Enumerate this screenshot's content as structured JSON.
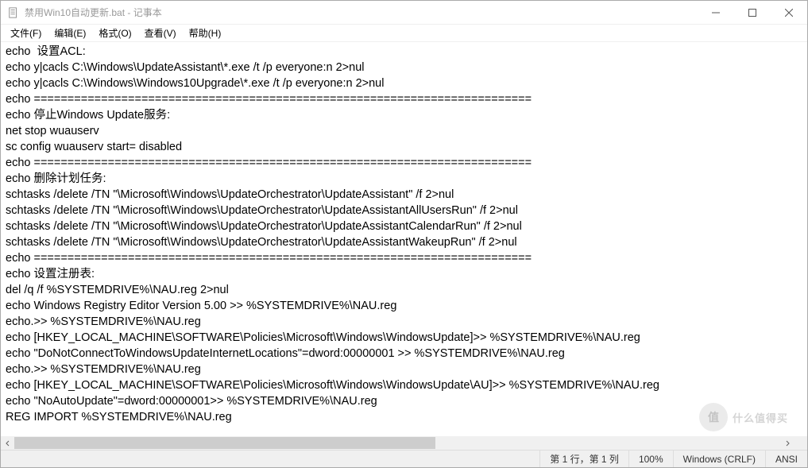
{
  "window": {
    "title": "禁用Win10自动更新.bat - 记事本"
  },
  "menu": {
    "file": "文件(F)",
    "edit": "编辑(E)",
    "format": "格式(O)",
    "view": "查看(V)",
    "help": "帮助(H)"
  },
  "content": {
    "lines": [
      "echo  设置ACL:",
      "echo y|cacls C:\\Windows\\UpdateAssistant\\*.exe /t /p everyone:n 2>nul",
      "echo y|cacls C:\\Windows\\Windows10Upgrade\\*.exe /t /p everyone:n 2>nul",
      "echo ==========================================================================",
      "echo 停止Windows Update服务:",
      "net stop wuauserv",
      "sc config wuauserv start= disabled",
      "echo ==========================================================================",
      "echo 删除计划任务:",
      "schtasks /delete /TN \"\\Microsoft\\Windows\\UpdateOrchestrator\\UpdateAssistant\" /f 2>nul",
      "schtasks /delete /TN \"\\Microsoft\\Windows\\UpdateOrchestrator\\UpdateAssistantAllUsersRun\" /f 2>nul",
      "schtasks /delete /TN \"\\Microsoft\\Windows\\UpdateOrchestrator\\UpdateAssistantCalendarRun\" /f 2>nul",
      "schtasks /delete /TN \"\\Microsoft\\Windows\\UpdateOrchestrator\\UpdateAssistantWakeupRun\" /f 2>nul",
      "echo ==========================================================================",
      "echo 设置注册表:",
      "del /q /f %SYSTEMDRIVE%\\NAU.reg 2>nul",
      "echo Windows Registry Editor Version 5.00 >> %SYSTEMDRIVE%\\NAU.reg",
      "echo.>> %SYSTEMDRIVE%\\NAU.reg",
      "echo [HKEY_LOCAL_MACHINE\\SOFTWARE\\Policies\\Microsoft\\Windows\\WindowsUpdate]>> %SYSTEMDRIVE%\\NAU.reg",
      "echo \"DoNotConnectToWindowsUpdateInternetLocations\"=dword:00000001 >> %SYSTEMDRIVE%\\NAU.reg",
      "echo.>> %SYSTEMDRIVE%\\NAU.reg",
      "echo [HKEY_LOCAL_MACHINE\\SOFTWARE\\Policies\\Microsoft\\Windows\\WindowsUpdate\\AU]>> %SYSTEMDRIVE%\\NAU.reg",
      "echo \"NoAutoUpdate\"=dword:00000001>> %SYSTEMDRIVE%\\NAU.reg",
      "REG IMPORT %SYSTEMDRIVE%\\NAU.reg"
    ]
  },
  "status": {
    "pos": "第 1 行，第 1 列",
    "zoom": "100%",
    "lineending": "Windows (CRLF)",
    "encoding": "ANSI"
  },
  "watermark": {
    "badge": "值",
    "text": "什么值得买"
  }
}
